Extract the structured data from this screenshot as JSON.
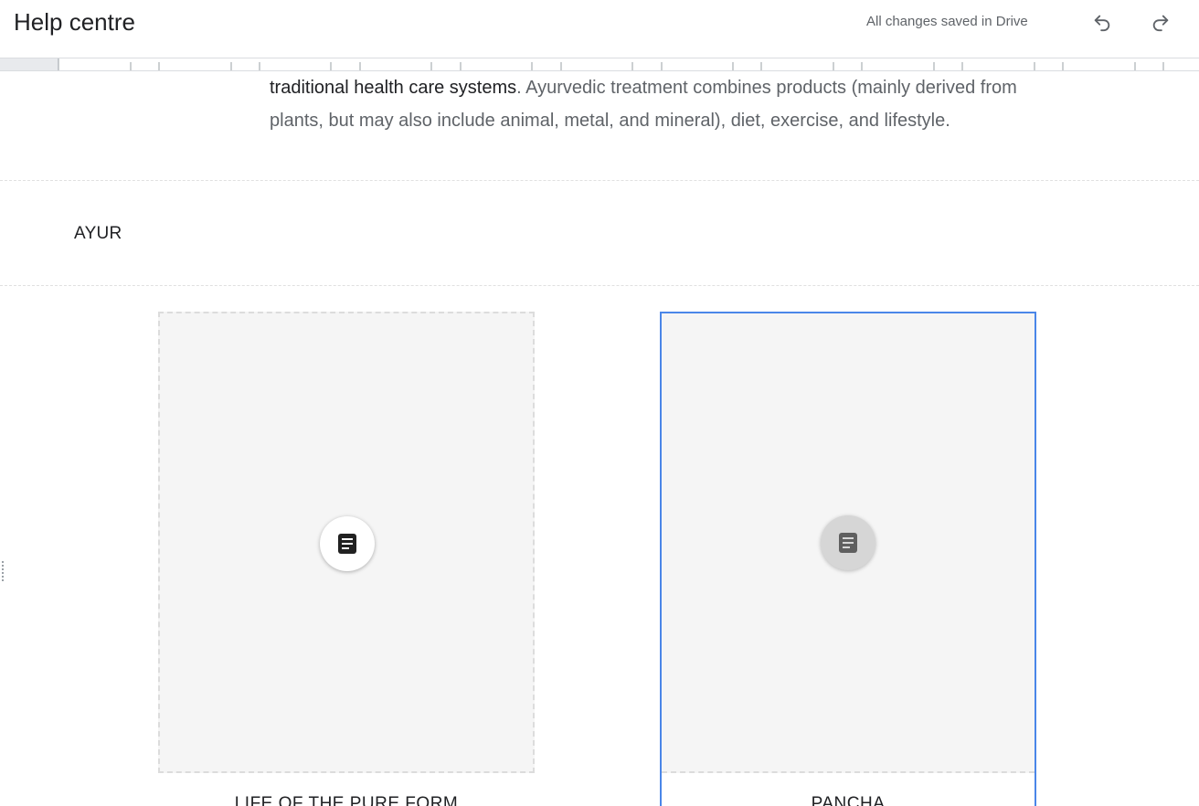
{
  "header": {
    "title": "Help centre",
    "save_status": "All changes saved in Drive",
    "undo_icon": "undo-icon",
    "redo_icon": "redo-icon"
  },
  "text_block": {
    "dark_part": "traditional health care systems",
    "rest": ". Ayurvedic treatment combines products (mainly derived from plants, but may also include animal, metal, and mineral), diet, exercise, and lifestyle."
  },
  "heading": {
    "text": "AYUR"
  },
  "cards": [
    {
      "caption": "LIFE OF THE PURE FORM",
      "icon": "document-icon",
      "selected": false
    },
    {
      "caption": "PANCHA",
      "icon": "document-icon",
      "selected": true
    }
  ],
  "colors": {
    "accent": "#4a86e8",
    "placeholder_bg": "#f5f5f5",
    "muted_text": "#5f6368"
  }
}
